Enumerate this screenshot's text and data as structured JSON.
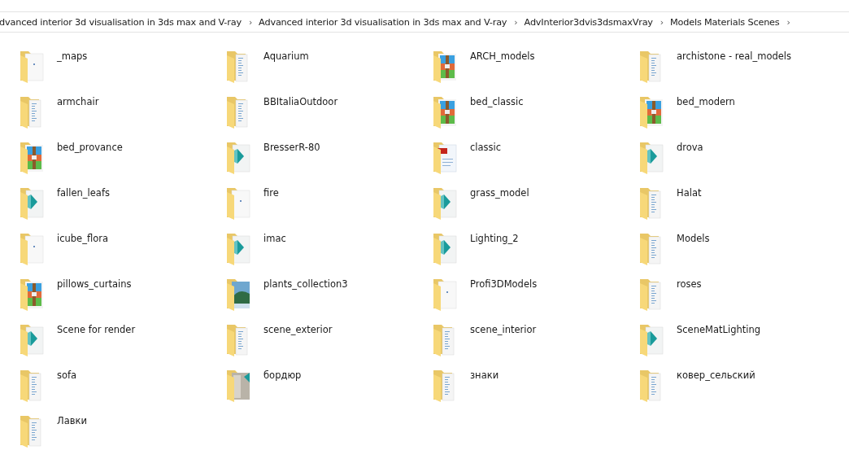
{
  "breadcrumb": [
    {
      "label": "dvanced interior 3d visualisation in 3ds max and V-ray",
      "separator": "›"
    },
    {
      "label": "Advanced interior 3d visualisation in 3ds max and V-ray",
      "separator": "›"
    },
    {
      "label": "AdvInterior3dvis3dsmaxVray",
      "separator": "›"
    },
    {
      "label": "Models Materials Scenes",
      "separator": "›"
    }
  ],
  "items": [
    {
      "name": "_maps",
      "kind": "page"
    },
    {
      "name": "Aquarium",
      "kind": "docs"
    },
    {
      "name": "ARCH_models",
      "kind": "archive"
    },
    {
      "name": "archistone - real_models",
      "kind": "docs"
    },
    {
      "name": "armchair",
      "kind": "docs"
    },
    {
      "name": "BBItaliaOutdoor",
      "kind": "docs"
    },
    {
      "name": "bed_classic",
      "kind": "archive"
    },
    {
      "name": "bed_modern",
      "kind": "archive"
    },
    {
      "name": "bed_provance",
      "kind": "archive"
    },
    {
      "name": "BresserR-80",
      "kind": "max"
    },
    {
      "name": "classic",
      "kind": "pdf"
    },
    {
      "name": "drova",
      "kind": "max"
    },
    {
      "name": "fallen_leafs",
      "kind": "max"
    },
    {
      "name": "fire",
      "kind": "page"
    },
    {
      "name": "grass_model",
      "kind": "max"
    },
    {
      "name": "Halat",
      "kind": "docs"
    },
    {
      "name": "icube_flora",
      "kind": "page"
    },
    {
      "name": "imac",
      "kind": "max"
    },
    {
      "name": "Lighting_2",
      "kind": "max"
    },
    {
      "name": "Models",
      "kind": "docs"
    },
    {
      "name": "pillows_curtains",
      "kind": "archive"
    },
    {
      "name": "plants_collection3",
      "kind": "photo"
    },
    {
      "name": "Profi3DModels",
      "kind": "page"
    },
    {
      "name": "roses",
      "kind": "docs"
    },
    {
      "name": "Scene for render",
      "kind": "max"
    },
    {
      "name": "scene_exterior",
      "kind": "docs"
    },
    {
      "name": "scene_interior",
      "kind": "docs"
    },
    {
      "name": "SceneMatLighting",
      "kind": "max"
    },
    {
      "name": "sofa",
      "kind": "docs"
    },
    {
      "name": "бордюр",
      "kind": "texture"
    },
    {
      "name": "знаки",
      "kind": "docs"
    },
    {
      "name": "ковер_сельский",
      "kind": "docs"
    },
    {
      "name": "Лавки",
      "kind": "docs"
    }
  ]
}
